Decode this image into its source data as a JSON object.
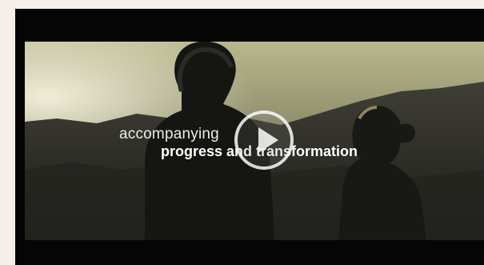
{
  "video": {
    "caption_line1": "accompanying",
    "caption_line2": "progress and transformation",
    "play_icon": "play-icon"
  }
}
